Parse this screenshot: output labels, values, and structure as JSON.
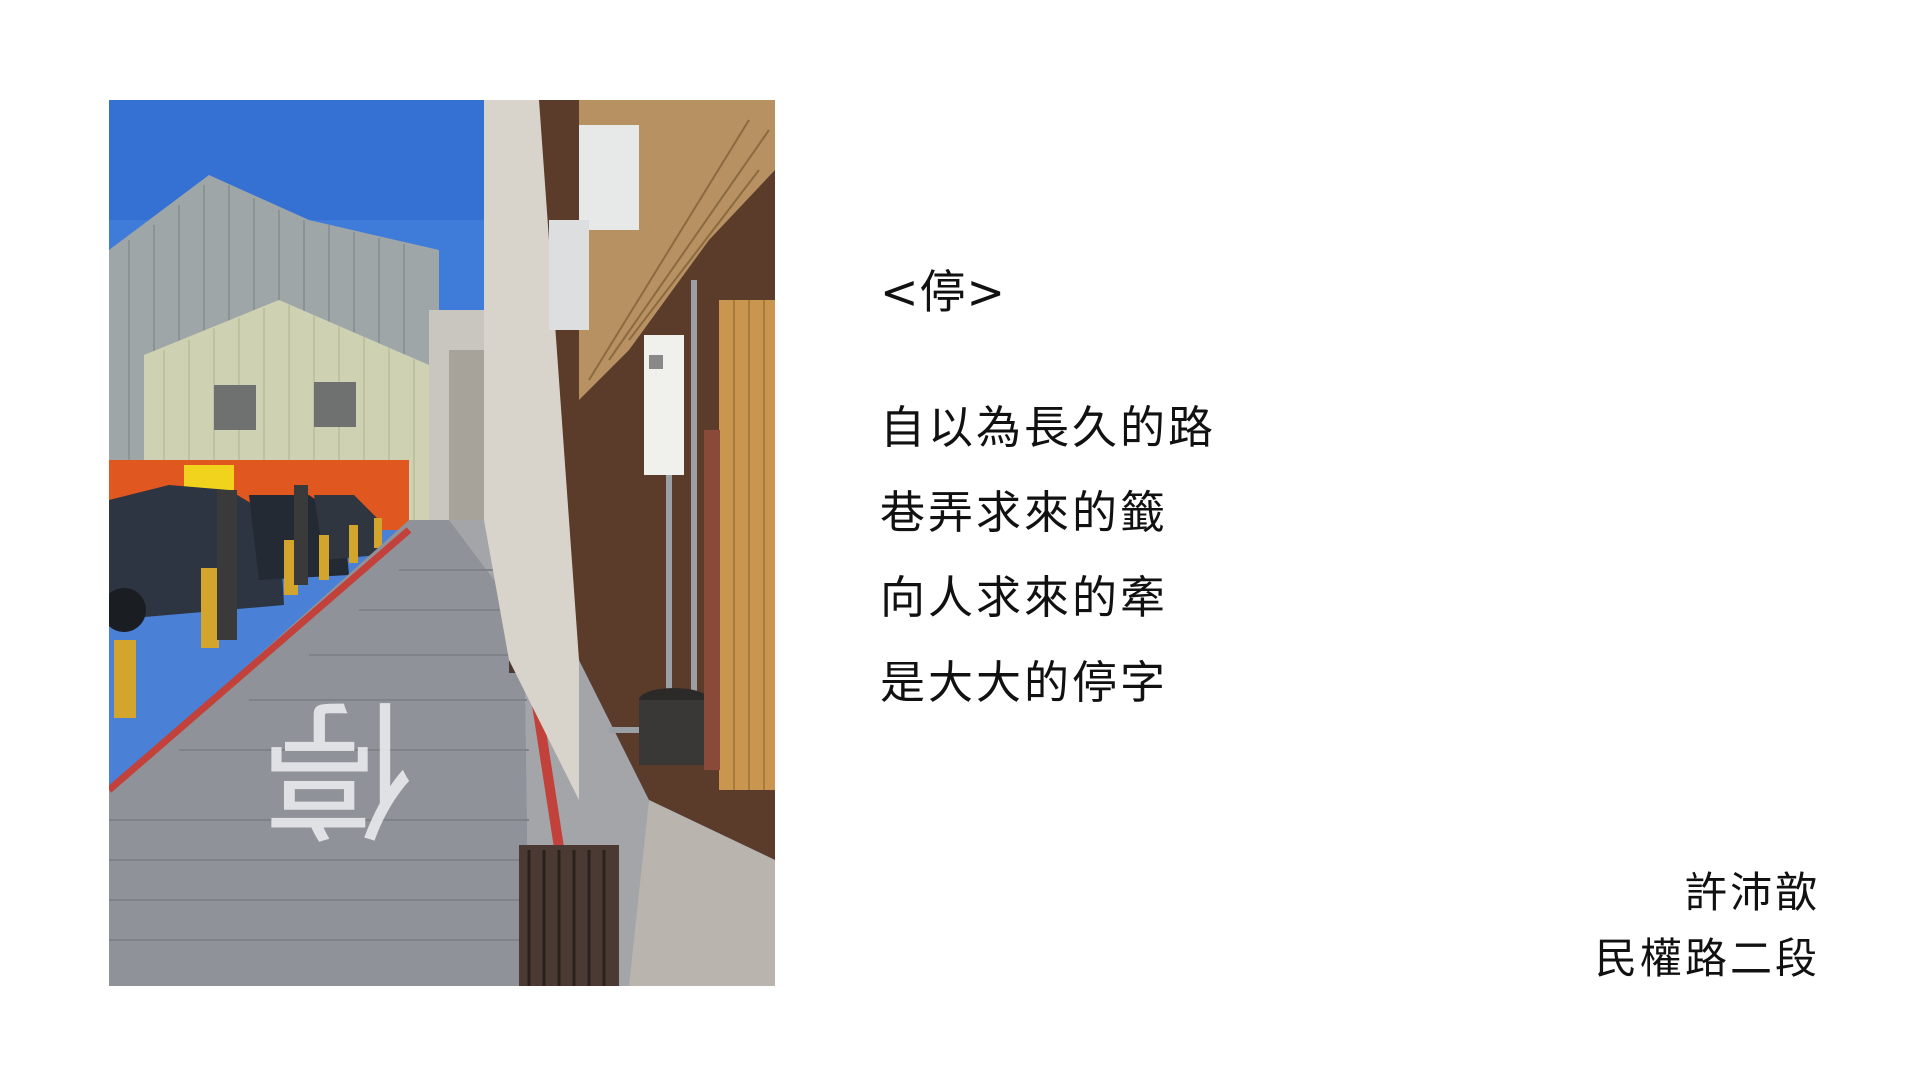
{
  "slide": {
    "title": "<停>",
    "poem_lines": [
      "自以為長久的路",
      "巷弄求來的籤",
      "向人求來的牽",
      "是大大的停字"
    ],
    "author": "許沛歆",
    "location": "民權路二段"
  },
  "photo": {
    "subject": "alley-street-with-stop-marking",
    "road_marking_text": "停",
    "colors": {
      "sky": "#3f7bd9",
      "pavement": "#8f9298",
      "red_curb": "#c2413a",
      "bollard": "#d4a52c",
      "orange_fence": "#e0581f",
      "wood": "#c9954f"
    }
  }
}
